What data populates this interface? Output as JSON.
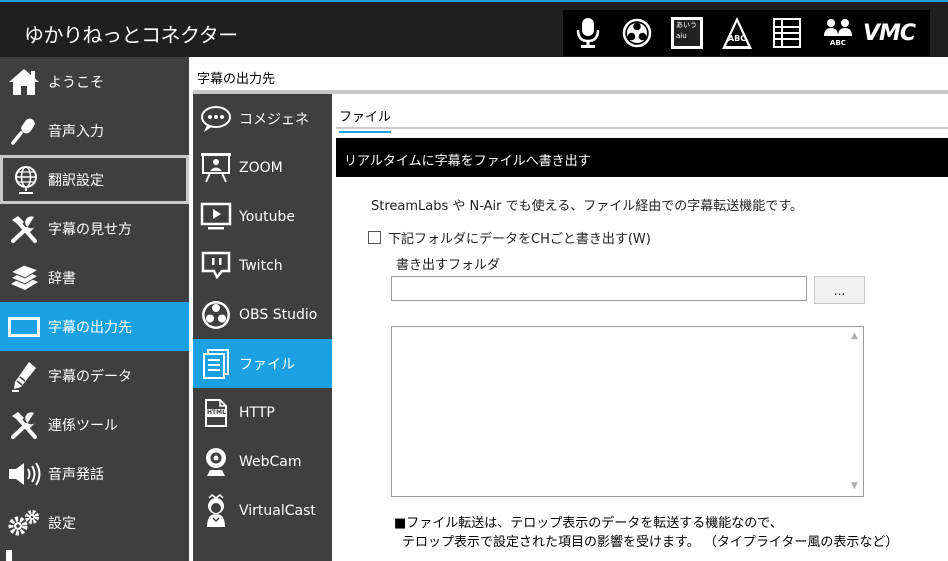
{
  "app": {
    "title": "ゆかりねっとコネクター"
  },
  "toolbar": {
    "items": [
      {
        "icon": "microphone-icon"
      },
      {
        "icon": "obs-icon"
      },
      {
        "icon": "aiueo-icon",
        "text_top": "あいう",
        "text_bottom": "aiu"
      },
      {
        "icon": "abc-chart-icon",
        "text": "ABC"
      },
      {
        "icon": "table-text-icon"
      },
      {
        "icon": "users-abc-icon",
        "text": "ABC"
      },
      {
        "icon": "vmc-icon",
        "text": "VMC"
      }
    ]
  },
  "sidebar": {
    "items": [
      {
        "label": "ようこそ",
        "icon": "home-icon"
      },
      {
        "label": "音声入力",
        "icon": "microphone-icon"
      },
      {
        "label": "翻訳設定",
        "icon": "globe-icon"
      },
      {
        "label": "字幕の見せ方",
        "icon": "tools-icon"
      },
      {
        "label": "辞書",
        "icon": "books-icon"
      },
      {
        "label": "字幕の出力先",
        "icon": "monitor-icon"
      },
      {
        "label": "字幕のデータ",
        "icon": "pen-icon"
      },
      {
        "label": "連係ツール",
        "icon": "tools-icon"
      },
      {
        "label": "音声発話",
        "icon": "speaker-icon"
      },
      {
        "label": "設定",
        "icon": "gears-icon"
      }
    ]
  },
  "section": {
    "title": "字幕の出力先"
  },
  "subnav": {
    "items": [
      {
        "label": "コメジェネ",
        "icon": "speech-bubble-icon"
      },
      {
        "label": "ZOOM",
        "icon": "presentation-icon"
      },
      {
        "label": "Youtube",
        "icon": "play-screen-icon"
      },
      {
        "label": "Twitch",
        "icon": "twitch-icon"
      },
      {
        "label": "OBS Studio",
        "icon": "obs-icon"
      },
      {
        "label": "ファイル",
        "icon": "document-icon"
      },
      {
        "label": "HTTP",
        "icon": "html-file-icon",
        "badge": "HTML"
      },
      {
        "label": "WebCam",
        "icon": "webcam-icon"
      },
      {
        "label": "VirtualCast",
        "icon": "avatar-icon"
      }
    ]
  },
  "content": {
    "tab_label": "ファイル",
    "banner": "リアルタイムに字幕をファイルへ書き出す",
    "description": "StreamLabs や N-Air でも使える、ファイル経由での字幕転送機能です。",
    "checkbox_label": "下記フォルダにデータをCHごと書き出す(W)",
    "checkbox_checked": false,
    "folder_label": "書き出すフォルダ",
    "folder_value": "",
    "browse_label": "...",
    "log_text": "",
    "note_line1": "■ファイル転送は、テロップ表示のデータを転送する機能なので、",
    "note_line2": "テロップ表示で設定された項目の影響を受けます。 （タイプライター風の表示など）"
  }
}
